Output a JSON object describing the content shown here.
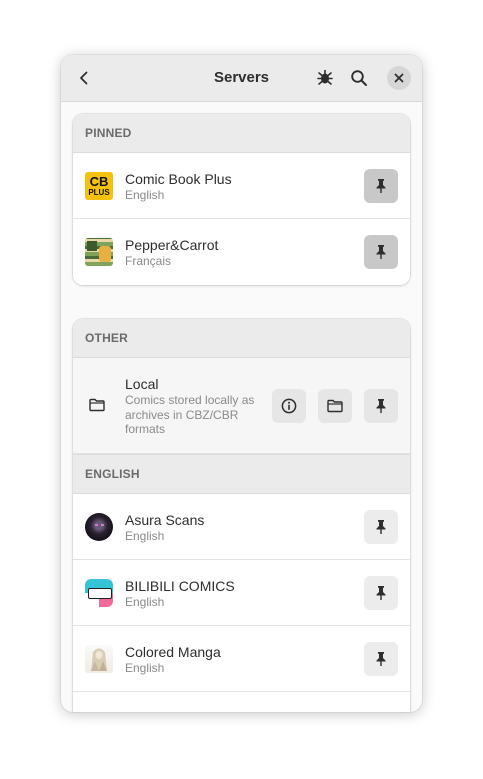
{
  "header": {
    "title": "Servers",
    "back_icon": "chevron-left-icon",
    "bug_icon": "bug-icon",
    "search_icon": "search-icon",
    "close_icon": "close-icon"
  },
  "pinned": {
    "heading": "PINNED",
    "items": [
      {
        "name": "Comic Book Plus",
        "language": "English",
        "thumb_text_1": "CB",
        "thumb_text_2": "PLUS"
      },
      {
        "name": "Pepper&Carrot",
        "language": "Français"
      }
    ]
  },
  "other": {
    "heading": "OTHER",
    "local": {
      "name": "Local",
      "description": "Comics stored locally as archives in CBZ/CBR formats"
    },
    "english_heading": "ENGLISH",
    "english": [
      {
        "name": "Asura Scans",
        "language": "English"
      },
      {
        "name": "BILIBILI COMICS",
        "language": "English"
      },
      {
        "name": "Colored Manga",
        "language": "English"
      }
    ]
  },
  "colors": {
    "accent_yellow": "#f4c20d",
    "header_bg": "#ebebeb",
    "pin_active_bg": "#c8c8c8"
  }
}
